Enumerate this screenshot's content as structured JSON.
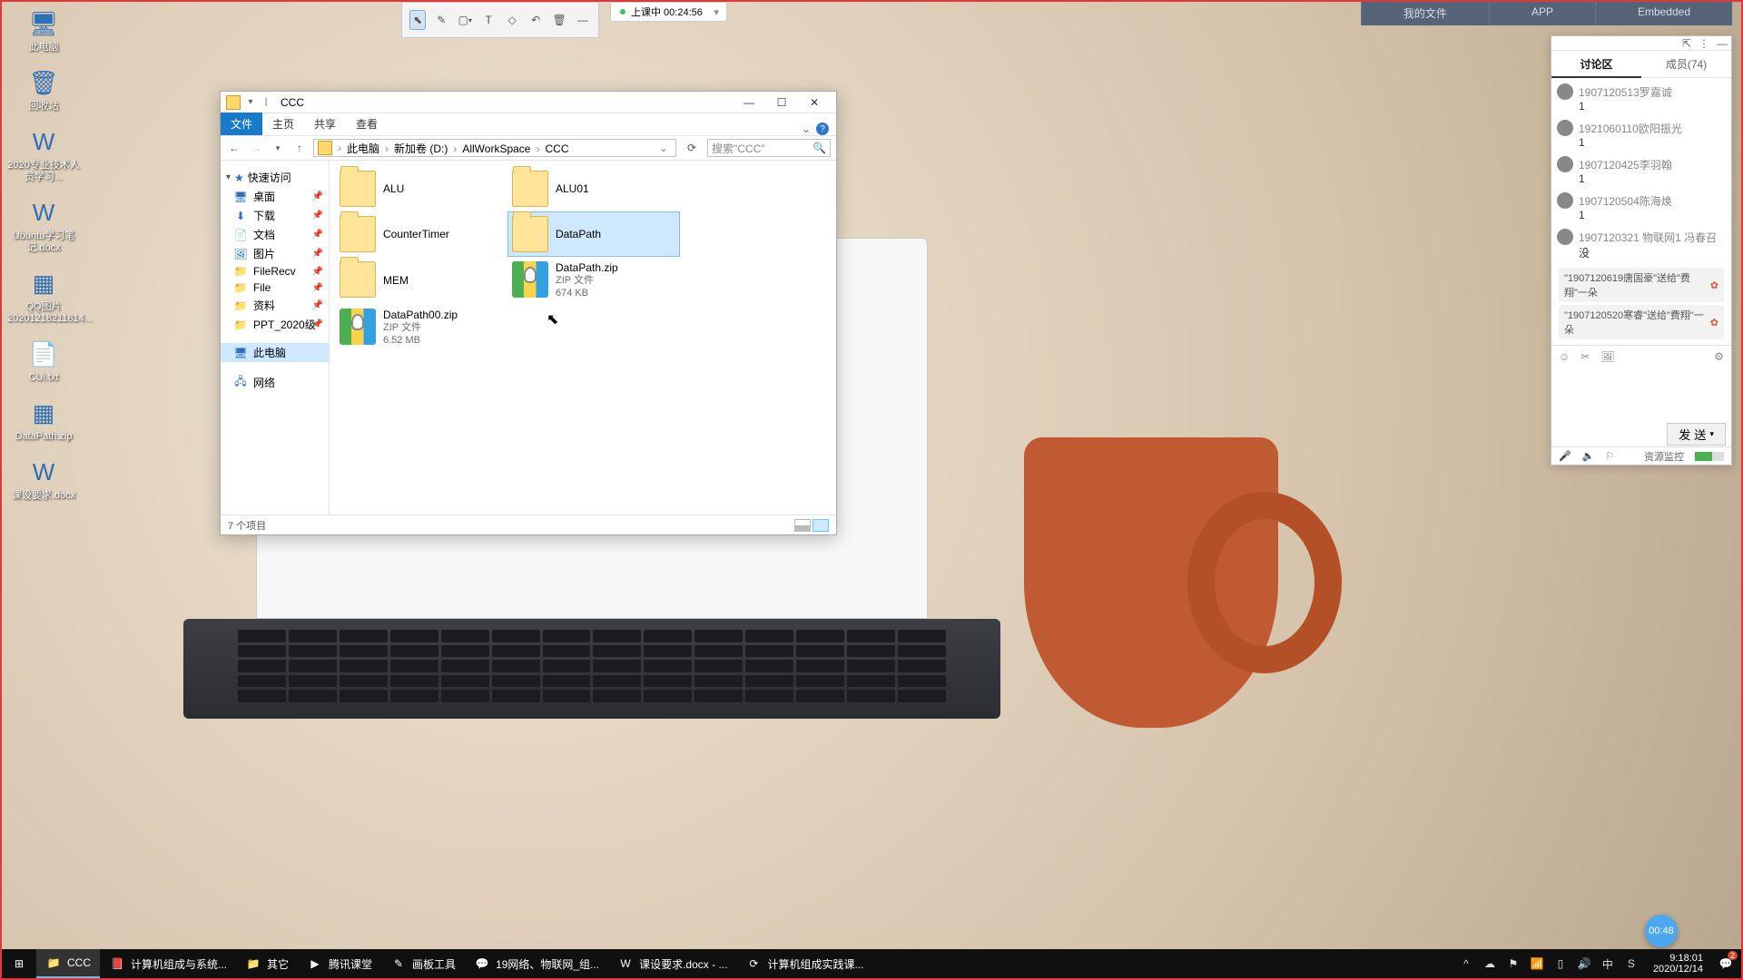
{
  "desktop_icons": [
    {
      "label": "此电脑",
      "glyph": "🖥"
    },
    {
      "label": "回收站",
      "glyph": "🗑"
    },
    {
      "label": "2020专业技术人员学习...",
      "glyph": "W"
    },
    {
      "label": "Ubuntu学习笔记.docx",
      "glyph": "W"
    },
    {
      "label": "QQ图片20201218211814...",
      "glyph": "▦"
    },
    {
      "label": "CUi.txt",
      "glyph": "📄"
    },
    {
      "label": "DataPath.zip",
      "glyph": "▦"
    },
    {
      "label": "课设要求.docx",
      "glyph": "W"
    }
  ],
  "annot_toolbar": {
    "min": "—"
  },
  "status_chip": {
    "label": "上课中 00:24:56"
  },
  "top_nav": [
    "我的文件",
    "APP",
    "Embedded"
  ],
  "explorer": {
    "title": "CCC",
    "tabs": [
      "文件",
      "主页",
      "共享",
      "查看"
    ],
    "active_tab": 0,
    "breadcrumb": [
      "此电脑",
      "新加卷 (D:)",
      "AllWorkSpace",
      "CCC"
    ],
    "search_placeholder": "搜索\"CCC\"",
    "nav_quick": "快速访问",
    "nav_items": [
      {
        "label": "桌面",
        "glyph": "🖥",
        "pin": true
      },
      {
        "label": "下载",
        "glyph": "⬇",
        "pin": true
      },
      {
        "label": "文档",
        "glyph": "📄",
        "pin": true
      },
      {
        "label": "图片",
        "glyph": "🖼",
        "pin": true
      },
      {
        "label": "FileRecv",
        "glyph": "📁",
        "pin": true
      },
      {
        "label": "File",
        "glyph": "📁",
        "pin": true
      },
      {
        "label": "资料",
        "glyph": "📁",
        "pin": true
      },
      {
        "label": "PPT_2020级",
        "glyph": "📁",
        "pin": true
      }
    ],
    "nav_thispc": "此电脑",
    "nav_network": "网络",
    "items": [
      {
        "name": "ALU",
        "type": "folder"
      },
      {
        "name": "ALU01",
        "type": "folder"
      },
      {
        "name": "CounterTimer",
        "type": "folder"
      },
      {
        "name": "DataPath",
        "type": "folder",
        "selected": true
      },
      {
        "name": "MEM",
        "type": "folder"
      },
      {
        "name": "DataPath.zip",
        "type": "zip",
        "sub1": "ZIP 文件",
        "sub2": "674 KB"
      },
      {
        "name": "DataPath00.zip",
        "type": "zip",
        "sub1": "ZIP 文件",
        "sub2": "6.52 MB"
      }
    ],
    "status": "7 个项目"
  },
  "chat": {
    "tabs": [
      "讨论区",
      "成员(74)"
    ],
    "messages": [
      {
        "name": "1907120513罗嘉诚",
        "text": "1"
      },
      {
        "name": "1921060110欧阳振光",
        "text": "1"
      },
      {
        "name": "1907120425李羽翰",
        "text": "1"
      },
      {
        "name": "1907120504陈海焕",
        "text": "1"
      },
      {
        "name": "1907120321 物联网1 冯春召",
        "text": "没"
      }
    ],
    "gifts": [
      "\"1907120619唐国豪\"送给\"费翔\"一朵",
      "\"1907120520寒睿\"送给\"费翔\"一朵"
    ],
    "send_label": "发 送",
    "monitor_label": "资源监控"
  },
  "timer_bubble": "00:48",
  "taskbar": {
    "items": [
      {
        "label": "CCC",
        "icon": "📁",
        "active": true
      },
      {
        "label": "计算机组成与系统...",
        "icon": "📕"
      },
      {
        "label": "其它",
        "icon": "📁"
      },
      {
        "label": "腾讯课堂",
        "icon": "▶"
      },
      {
        "label": "画板工具",
        "icon": "✎"
      },
      {
        "label": "19网络、物联网_组...",
        "icon": "💬"
      },
      {
        "label": "课设要求.docx - ...",
        "icon": "W"
      },
      {
        "label": "计算机组成实践课...",
        "icon": "⟳"
      }
    ],
    "tray_icons": [
      "^",
      "☁",
      "⚑",
      "📶",
      "▯",
      "🔊",
      "中",
      "S"
    ],
    "clock_time": "9:18:01",
    "clock_date": "2020/12/14",
    "notif_count": "2"
  }
}
